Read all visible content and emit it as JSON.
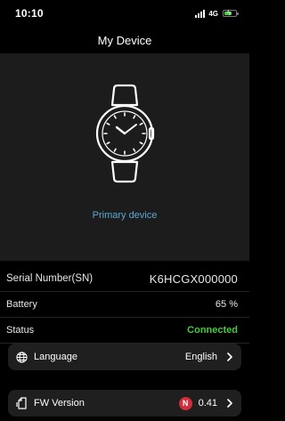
{
  "status_bar": {
    "time": "10:10",
    "network": "4G"
  },
  "header": {
    "title": "My Device"
  },
  "device": {
    "primary_label": "Primary device"
  },
  "info": {
    "serial": {
      "label": "Serial Number(SN)",
      "value": "K6HCGX000000"
    },
    "battery": {
      "label": "Battery",
      "value": "65 %"
    },
    "status": {
      "label": "Status",
      "value": "Connected"
    }
  },
  "settings": {
    "language": {
      "label": "Language",
      "value": "English",
      "icon": "globe-icon"
    },
    "fw_version": {
      "label": "FW Version",
      "value": "0.41",
      "badge": "N",
      "icon": "document-icon"
    }
  },
  "colors": {
    "background": "#000000",
    "panel": "#1c1c1c",
    "card": "#1f1f1f",
    "accent_blue": "#5aa9d6",
    "connected_green": "#47c93f",
    "badge_red": "#d12d3a",
    "battery_green": "#3dd13d"
  }
}
